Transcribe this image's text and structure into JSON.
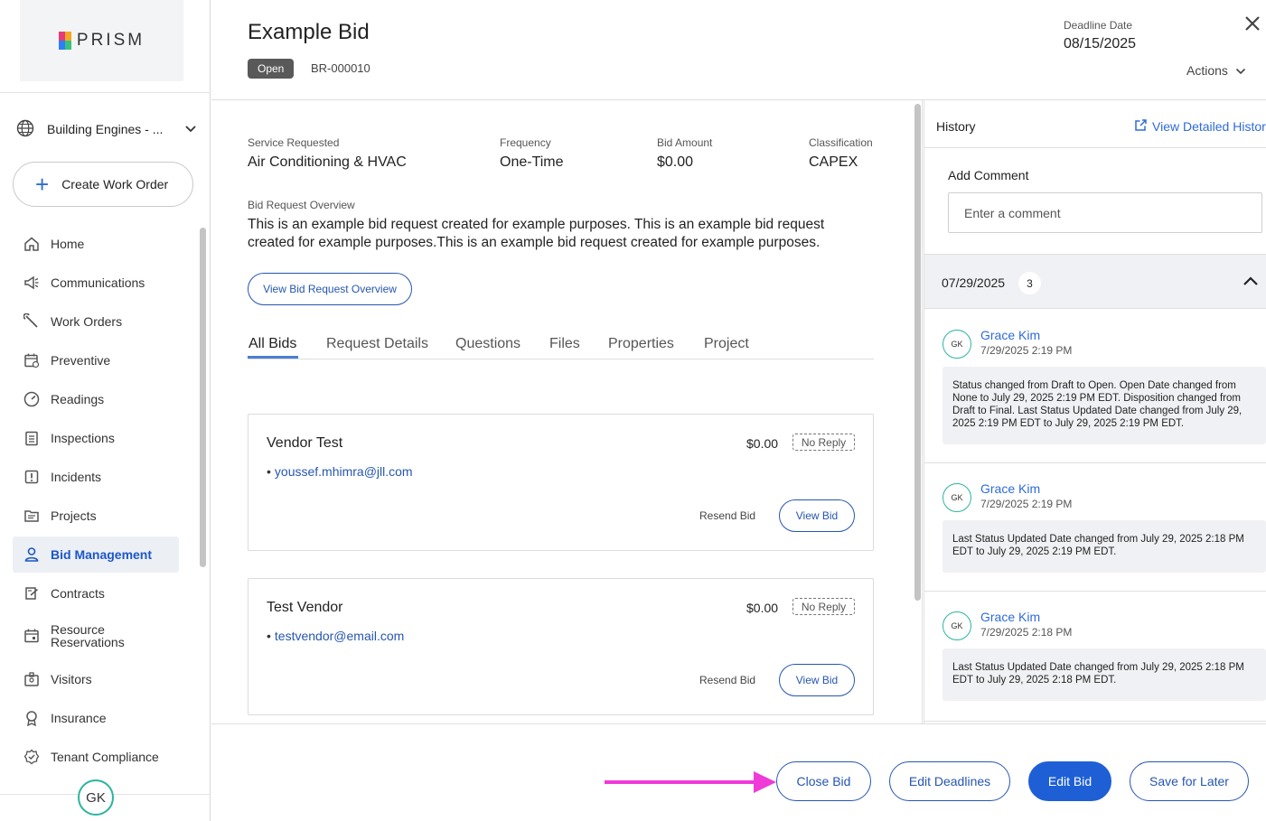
{
  "sidebar": {
    "logo_text": "PRISM",
    "site_selector": "Building Engines - ...",
    "create_button": "Create Work Order",
    "nav": [
      {
        "label": "Home",
        "icon": "home-icon"
      },
      {
        "label": "Communications",
        "icon": "megaphone-icon"
      },
      {
        "label": "Work Orders",
        "icon": "wrench-icon"
      },
      {
        "label": "Preventive",
        "icon": "calendar-icon"
      },
      {
        "label": "Readings",
        "icon": "gauge-icon"
      },
      {
        "label": "Inspections",
        "icon": "clipboard-icon"
      },
      {
        "label": "Incidents",
        "icon": "alert-icon"
      },
      {
        "label": "Projects",
        "icon": "folder-icon"
      },
      {
        "label": "Bid Management",
        "icon": "user-icon",
        "active": true
      },
      {
        "label": "Contracts",
        "icon": "contract-icon"
      },
      {
        "label": "Resource",
        "label2": "Reservations",
        "icon": "calendar-icon"
      },
      {
        "label": "Visitors",
        "icon": "badge-icon"
      },
      {
        "label": "Insurance",
        "icon": "ribbon-icon"
      },
      {
        "label": "Tenant Compliance",
        "icon": "check-badge-icon"
      }
    ],
    "user_initials": "GK"
  },
  "header": {
    "title": "Example Bid",
    "status": "Open",
    "bid_id": "BR-000010",
    "deadline_label": "Deadline Date",
    "deadline_value": "08/15/2025",
    "actions_label": "Actions"
  },
  "details": {
    "service_label": "Service Requested",
    "service_value": "Air Conditioning & HVAC",
    "frequency_label": "Frequency",
    "frequency_value": "One-Time",
    "amount_label": "Bid Amount",
    "amount_value": "$0.00",
    "classification_label": "Classification",
    "classification_value": "CAPEX",
    "overview_label": "Bid Request Overview",
    "overview_text": "This is an example bid request created for example purposes. This is an example bid request created for example purposes.This is an example bid request created for example purposes.",
    "view_overview_button": "View Bid Request Overview"
  },
  "tabs": [
    "All Bids",
    "Request Details",
    "Questions",
    "Files",
    "Properties",
    "Project"
  ],
  "vendors": [
    {
      "name": "Vendor Test",
      "amount": "$0.00",
      "status": "No Reply",
      "email": "youssef.mhimra@jll.com",
      "resend": "Resend Bid",
      "view": "View Bid"
    },
    {
      "name": "Test Vendor",
      "amount": "$0.00",
      "status": "No Reply",
      "email": "testvendor@email.com",
      "resend": "Resend Bid",
      "view": "View Bid"
    }
  ],
  "history": {
    "title": "History",
    "view_detailed": "View Detailed History",
    "add_comment_label": "Add Comment",
    "comment_placeholder": "Enter a comment",
    "group_date": "07/29/2025",
    "group_count": "3",
    "entries": [
      {
        "initials": "GK",
        "name": "Grace Kim",
        "time": "7/29/2025 2:19 PM",
        "message": "Status changed from Draft to Open. Open Date changed from None to July 29, 2025 2:19 PM EDT. Disposition changed from Draft to Final. Last Status Updated Date changed from July 29, 2025 2:19 PM EDT to July 29, 2025 2:19 PM EDT."
      },
      {
        "initials": "GK",
        "name": "Grace Kim",
        "time": "7/29/2025 2:19 PM",
        "message": "Last Status Updated Date changed from July 29, 2025 2:18 PM EDT to July 29, 2025 2:19 PM EDT."
      },
      {
        "initials": "GK",
        "name": "Grace Kim",
        "time": "7/29/2025 2:18 PM",
        "message": "Last Status Updated Date changed from July 29, 2025 2:18 PM EDT to July 29, 2025 2:18 PM EDT."
      }
    ]
  },
  "footer": {
    "close_bid": "Close Bid",
    "edit_deadlines": "Edit Deadlines",
    "edit_bid": "Edit Bid",
    "save_later": "Save for Later"
  },
  "colors": {
    "accent": "#1f5fd6",
    "link": "#2f6bd8",
    "annotation_arrow": "#f03ad8",
    "avatar_ring": "#2bb5a0"
  }
}
